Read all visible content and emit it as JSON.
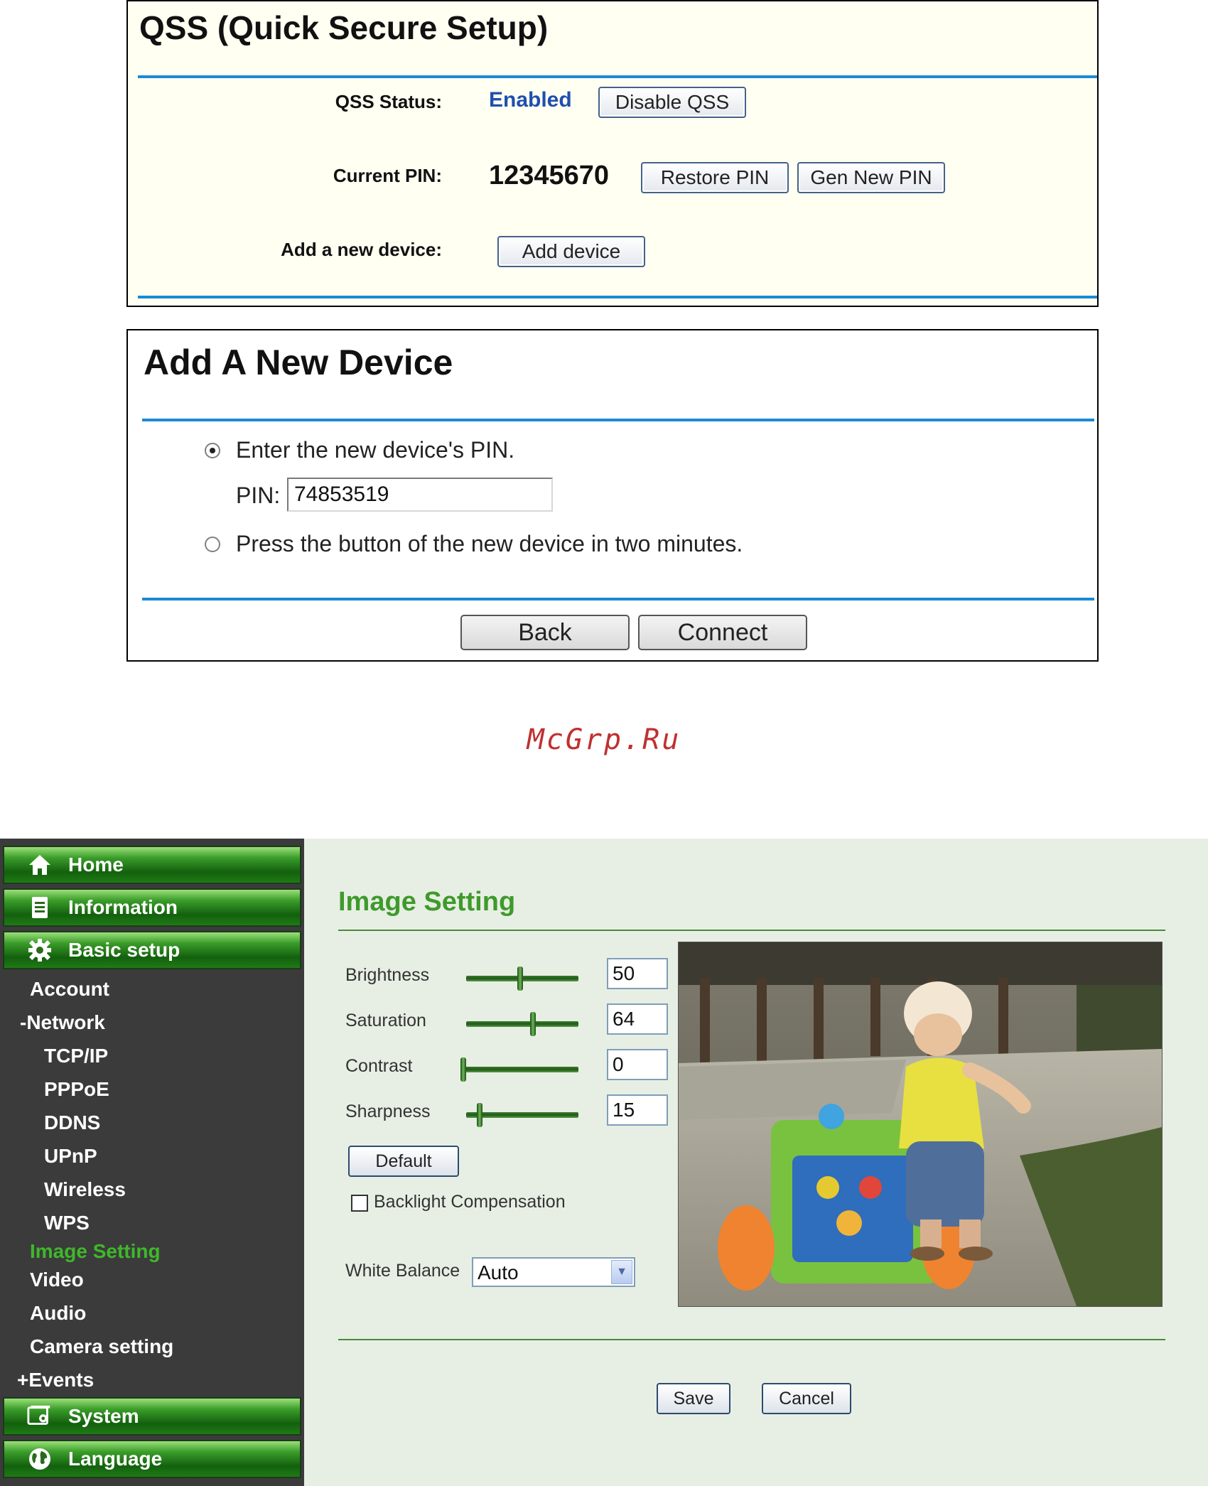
{
  "qss": {
    "title": "QSS (Quick Secure Setup)",
    "status_label": "QSS Status:",
    "status_value": "Enabled",
    "disable_button": "Disable QSS",
    "pin_label": "Current PIN:",
    "pin_value": "12345670",
    "restore_pin_button": "Restore PIN",
    "gen_pin_button": "Gen New PIN",
    "add_label": "Add a new device:",
    "add_button": "Add device"
  },
  "add_device": {
    "title": "Add A New Device",
    "option_pin": "Enter the new device's PIN.",
    "pin_label": "PIN:",
    "pin_value": "74853519",
    "option_button": "Press the button of the new device in two minutes.",
    "selected_option": "pin",
    "back_button": "Back",
    "connect_button": "Connect"
  },
  "watermark": "McGrp.Ru",
  "sidebar": {
    "nav": [
      {
        "label": "Home",
        "icon": "home-icon"
      },
      {
        "label": "Information",
        "icon": "document-icon"
      },
      {
        "label": "Basic setup",
        "icon": "gear-icon"
      },
      {
        "label": "System",
        "icon": "system-icon"
      },
      {
        "label": "Language",
        "icon": "globe-icon"
      }
    ],
    "items": [
      {
        "label": "Account"
      },
      {
        "label": "-Network"
      },
      {
        "label": "TCP/IP"
      },
      {
        "label": "PPPoE"
      },
      {
        "label": "DDNS"
      },
      {
        "label": "UPnP"
      },
      {
        "label": "Wireless"
      },
      {
        "label": "WPS"
      },
      {
        "label": "Image Setting",
        "active": true
      },
      {
        "label": "Video"
      },
      {
        "label": "Audio"
      },
      {
        "label": "Camera setting"
      },
      {
        "label": "+Events"
      }
    ]
  },
  "image_setting": {
    "title": "Image Setting",
    "sliders": [
      {
        "label": "Brightness",
        "value": "50",
        "level": 0.48
      },
      {
        "label": "Saturation",
        "value": "64",
        "level": 0.6
      },
      {
        "label": "Contrast",
        "value": "0",
        "level": 0.0
      },
      {
        "label": "Sharpness",
        "value": "15",
        "level": 0.1
      }
    ],
    "default_button": "Default",
    "backlight_label": "Backlight Compensation",
    "backlight_checked": false,
    "white_balance_label": "White Balance",
    "white_balance_value": "Auto",
    "save_button": "Save",
    "cancel_button": "Cancel"
  },
  "colors": {
    "accent_green": "#3f9a2c",
    "qss_status_blue": "#1f4fae",
    "rule_blue": "#1a8ad4",
    "watermark_red": "#c03030"
  }
}
